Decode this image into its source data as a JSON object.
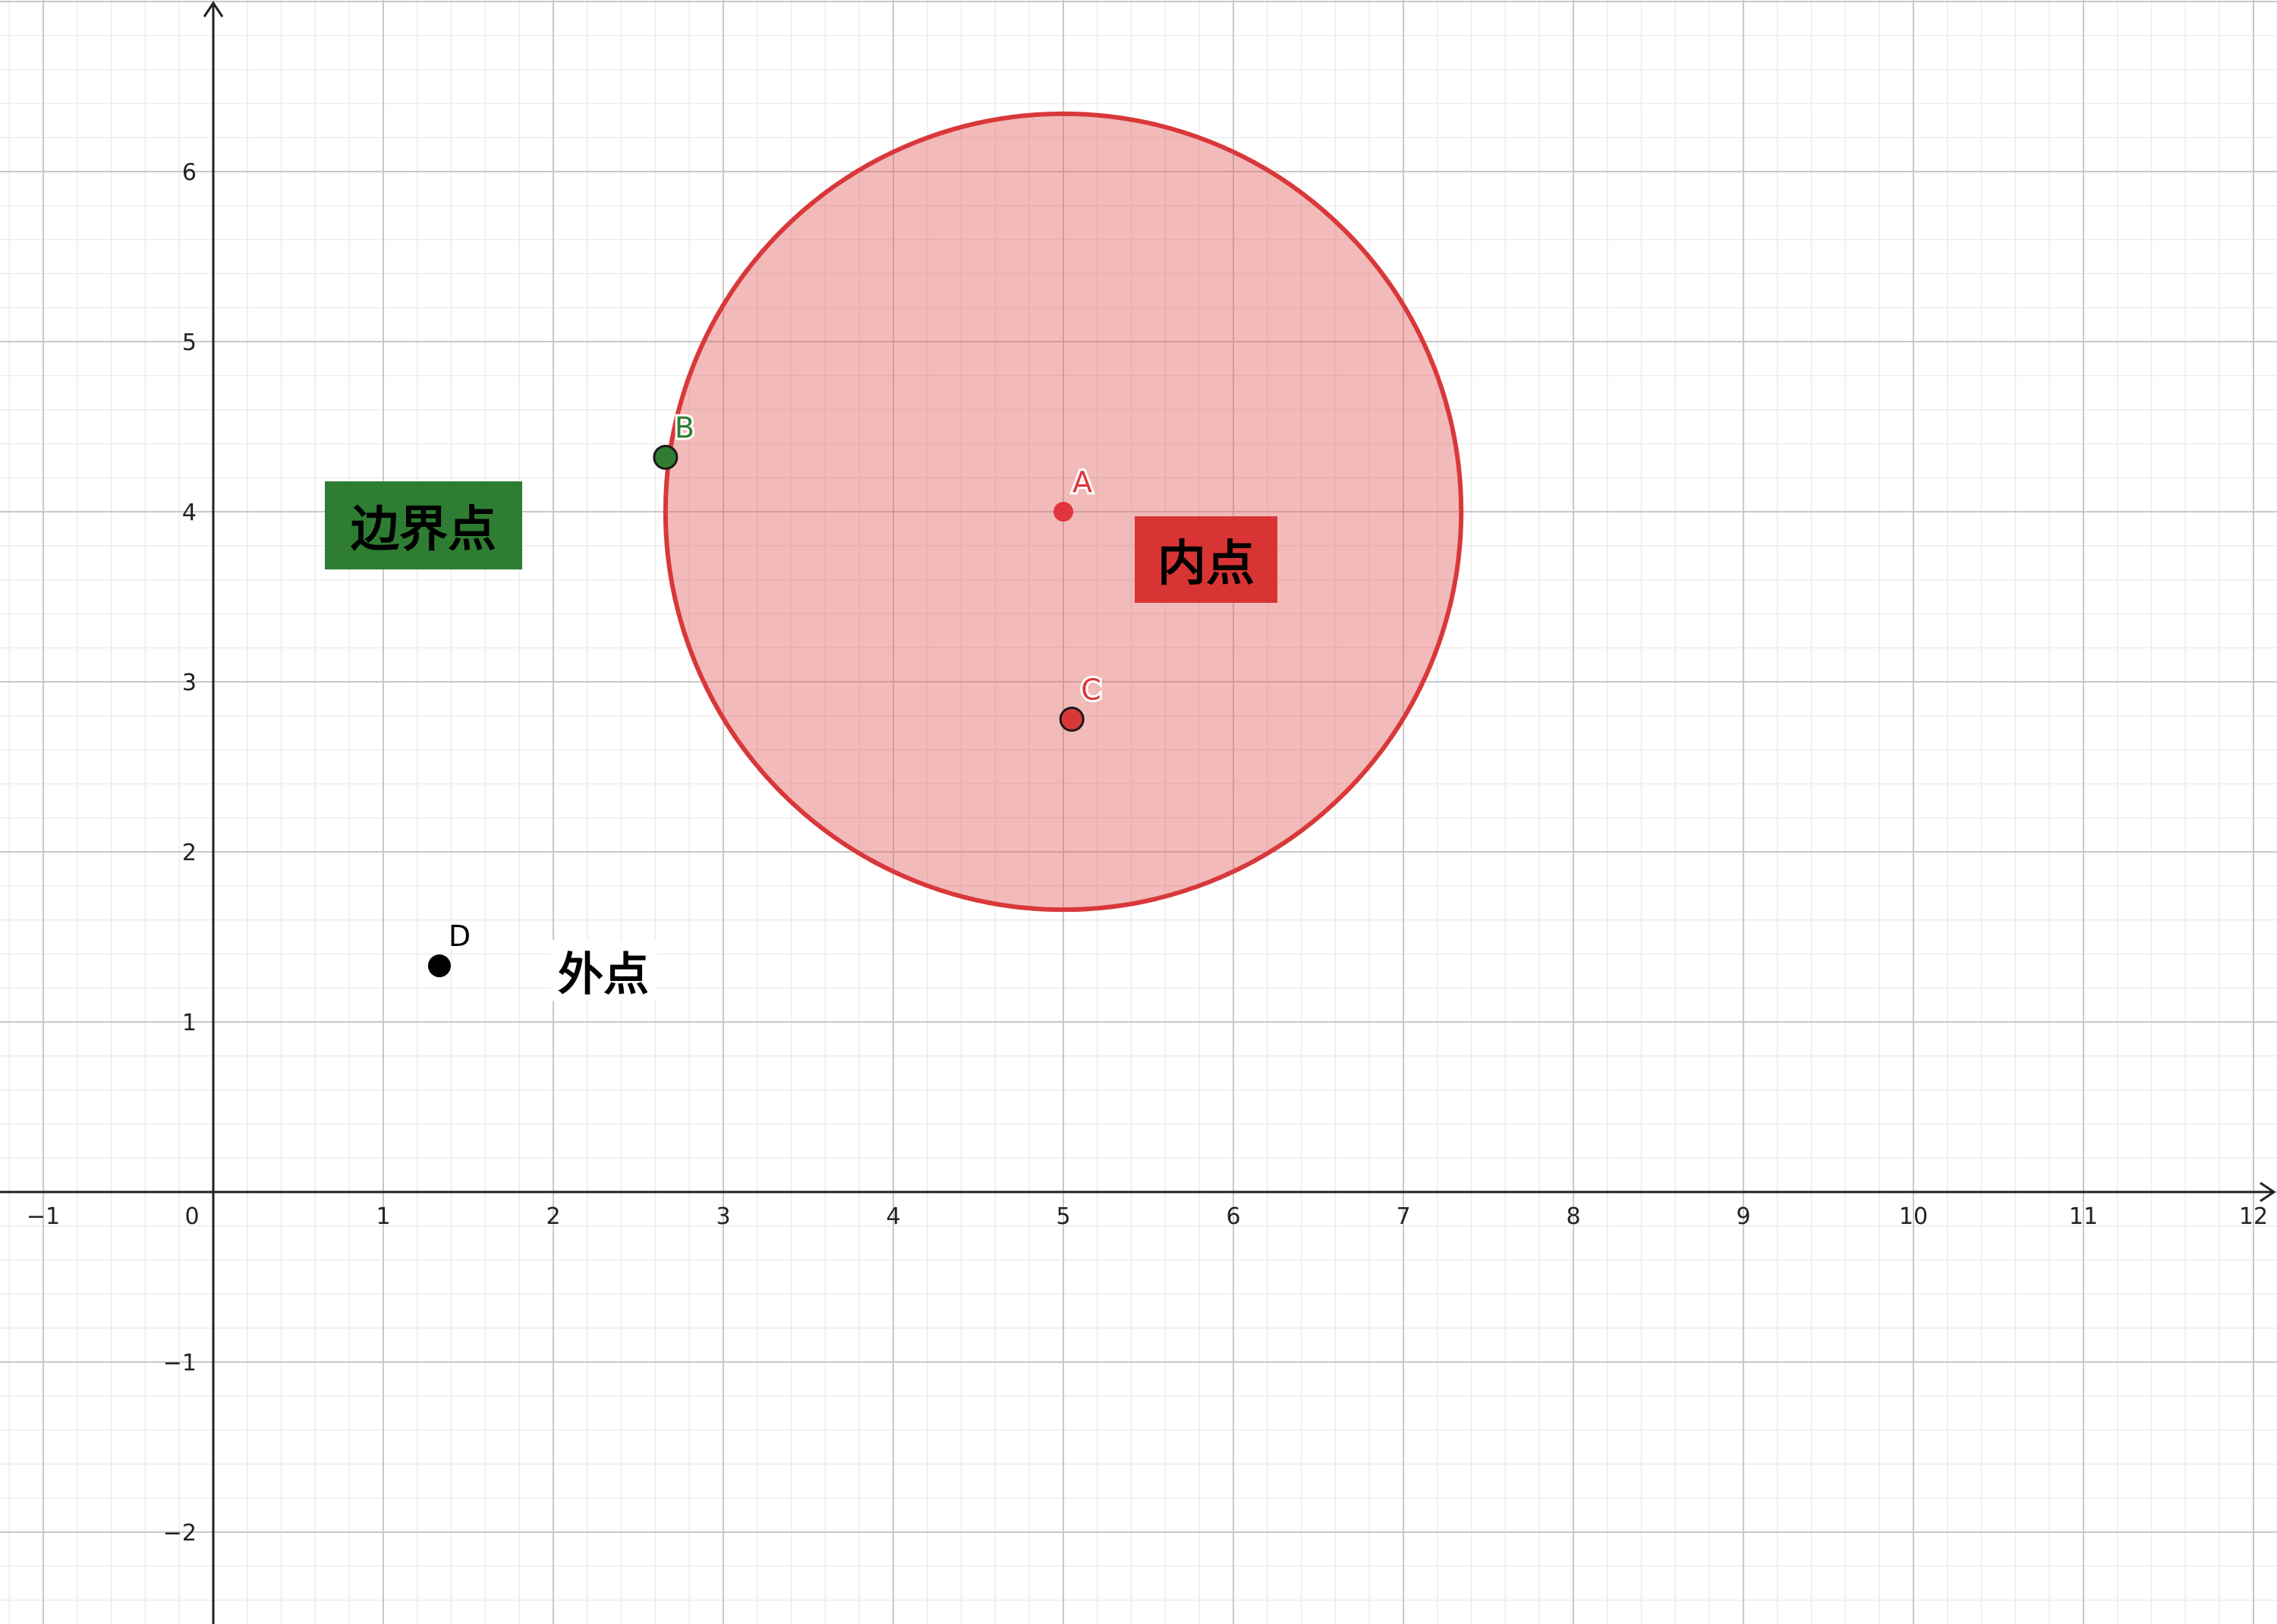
{
  "axes": {
    "x_range": [
      -1,
      12
    ],
    "y_range": [
      -2,
      6
    ],
    "x_ticks": [
      "−1",
      "0",
      "1",
      "2",
      "3",
      "4",
      "5",
      "6",
      "7",
      "8",
      "9",
      "10",
      "11",
      "12"
    ],
    "y_ticks": [
      "−2",
      "−1",
      "1",
      "2",
      "3",
      "4",
      "5",
      "6"
    ],
    "major_grid": 1,
    "minor_grid": 0.2,
    "grid": true
  },
  "circle": {
    "center": [
      5,
      4
    ],
    "radius": 2.34,
    "fill_color": "#e35b5b",
    "stroke_color": "#d9383a"
  },
  "points": [
    {
      "label": "A",
      "x": 5.0,
      "y": 4.0,
      "color": "#e0353d",
      "outlined": false
    },
    {
      "label": "B",
      "x": 2.66,
      "y": 4.32,
      "color": "#2e7d32",
      "outlined": true
    },
    {
      "label": "C",
      "x": 5.05,
      "y": 2.78,
      "color": "#d9383a",
      "outlined": true
    },
    {
      "label": "D",
      "x": 1.33,
      "y": 1.33,
      "color": "#000000",
      "outlined": false
    }
  ],
  "labels": {
    "boundary": {
      "text": "边界点",
      "bg": "#2e7d32"
    },
    "interior": {
      "text": "内点",
      "bg": "#d93434"
    },
    "exterior": {
      "text": "外点",
      "bg": "#ffffff"
    }
  }
}
